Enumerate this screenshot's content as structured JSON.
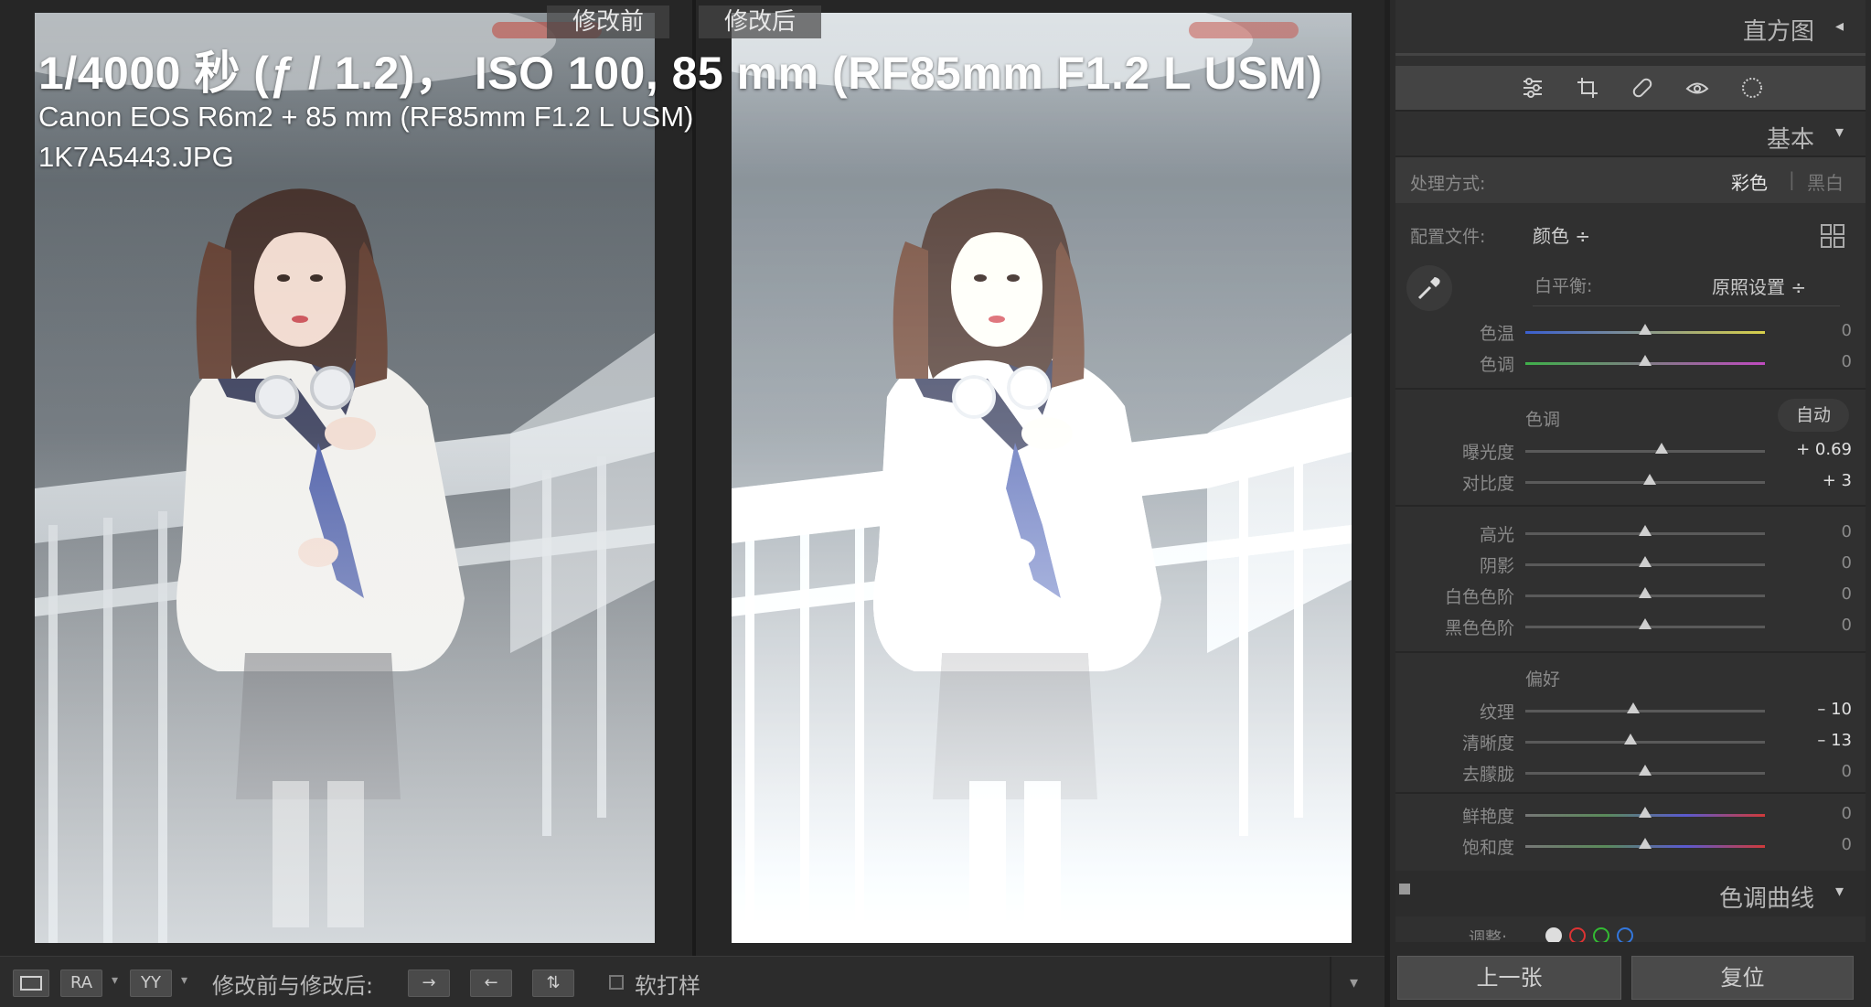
{
  "view": {
    "before_label": "修改前",
    "after_label": "修改后",
    "info_line1": "1/4000 秒 (ƒ / 1.2)， ISO 100, 85 mm (RF85mm F1.2 L USM)",
    "info_line2": "Canon EOS R6m2 + 85 mm (RF85mm F1.2 L USM)",
    "info_line3": "1K7A5443.JPG"
  },
  "toolbar": {
    "view_mode_a": "RA",
    "view_mode_b": "YY",
    "before_after_label": "修改前与修改后:",
    "softproof_label": "软打样"
  },
  "panel": {
    "histogram_title": "直方图",
    "basic_title": "基本",
    "treatment_label": "处理方式:",
    "treatment_color": "彩色",
    "treatment_divider": "|",
    "treatment_bw": "黑白",
    "profile_label": "配置文件:",
    "profile_value": "颜色 ÷",
    "wb_label": "白平衡:",
    "wb_value": "原照设置 ÷",
    "tone_section": "色调",
    "auto_button": "自动",
    "presence_section": "偏好",
    "tone_curve_title": "色调曲线",
    "curve_adjust_label": "调整:",
    "prev_button": "上一张",
    "reset_button": "复位"
  },
  "sliders": {
    "temp": {
      "label": "色温",
      "value": "0",
      "pos": 0.5
    },
    "tint": {
      "label": "色调",
      "value": "0",
      "pos": 0.5
    },
    "exposure": {
      "label": "曝光度",
      "value": "+ 0.69",
      "pos": 0.57
    },
    "contrast": {
      "label": "对比度",
      "value": "+ 3",
      "pos": 0.52
    },
    "highlights": {
      "label": "高光",
      "value": "0",
      "pos": 0.5
    },
    "shadows": {
      "label": "阴影",
      "value": "0",
      "pos": 0.5
    },
    "whites": {
      "label": "白色色阶",
      "value": "0",
      "pos": 0.5
    },
    "blacks": {
      "label": "黑色色阶",
      "value": "0",
      "pos": 0.5
    },
    "texture": {
      "label": "纹理",
      "value": "– 10",
      "pos": 0.45
    },
    "clarity": {
      "label": "清晰度",
      "value": "– 13",
      "pos": 0.44
    },
    "dehaze": {
      "label": "去朦胧",
      "value": "0",
      "pos": 0.5
    },
    "vibrance": {
      "label": "鲜艳度",
      "value": "0",
      "pos": 0.5
    },
    "saturation": {
      "label": "饱和度",
      "value": "0",
      "pos": 0.5
    }
  },
  "colors": {
    "panel_bg": "#303030",
    "tools_strip": "#444444",
    "photo_bg": "#5d6870"
  },
  "icons": [
    "basic-adjust-icon",
    "crop-icon",
    "heal-icon",
    "redeye-icon",
    "mask-icon",
    "eyedropper-icon",
    "grid-icon"
  ]
}
